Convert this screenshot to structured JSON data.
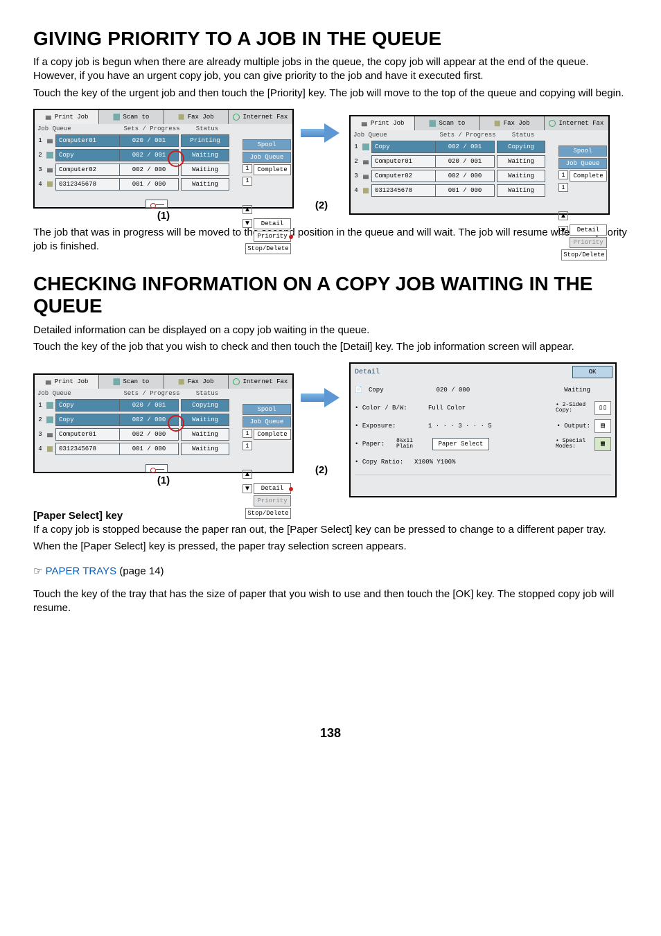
{
  "heading1": "GIVING PRIORITY TO A JOB IN THE QUEUE",
  "para1a": "If a copy job is begun when there are already multiple jobs in the queue, the copy job will appear at the end of the queue. However, if you have an urgent copy job, you can give priority to the job and have it executed first.",
  "para1b": "Touch the key of the urgent job and then touch the [Priority] key. The job will move to the top of the queue and copying will begin.",
  "tabs": [
    "Print Job",
    "Scan to",
    "Fax Job",
    "Internet Fax"
  ],
  "cols": {
    "c1": "Job Queue",
    "c2": "Sets / Progress",
    "c3": "Status"
  },
  "fig1_left": {
    "rows": [
      {
        "icon": "print",
        "name": "Computer01",
        "prog": "020 / 001",
        "status": "Printing",
        "shade": true
      },
      {
        "icon": "copy",
        "name": "Copy",
        "prog": "002 / 001",
        "status": "Waiting",
        "shade": true
      },
      {
        "icon": "print",
        "name": "Computer02",
        "prog": "002 / 000",
        "status": "Waiting",
        "shade": false
      },
      {
        "icon": "fax",
        "name": "0312345678",
        "prog": "001 / 000",
        "status": "Waiting",
        "shade": false
      }
    ],
    "side": {
      "spool": "Spool",
      "jobq": "Job Queue",
      "complete": "Complete",
      "detail": "Detail",
      "priority": "Priority",
      "stop": "Stop/Delete",
      "n1": "1",
      "n2": "1"
    }
  },
  "fig1_right": {
    "rows": [
      {
        "icon": "copy",
        "name": "Copy",
        "prog": "002 / 001",
        "status": "Copying",
        "shade": true
      },
      {
        "icon": "print",
        "name": "Computer01",
        "prog": "020 / 001",
        "status": "Waiting",
        "shade": false
      },
      {
        "icon": "print",
        "name": "Computer02",
        "prog": "002 / 000",
        "status": "Waiting",
        "shade": false
      },
      {
        "icon": "fax",
        "name": "0312345678",
        "prog": "001 / 000",
        "status": "Waiting",
        "shade": false
      }
    ],
    "side": {
      "spool": "Spool",
      "jobq": "Job Queue",
      "complete": "Complete",
      "detail": "Detail",
      "priority": "Priority",
      "stop": "Stop/Delete",
      "n1": "1",
      "n2": "1"
    }
  },
  "cap1": "(1)",
  "cap2": "(2)",
  "para1c": "The job that was in progress will be moved to the second position in the queue and will wait. The job will resume when the priority job is finished.",
  "heading2": "CHECKING INFORMATION ON A COPY JOB WAITING IN THE QUEUE",
  "para2a": "Detailed information can be displayed on a copy job waiting in the queue.",
  "para2b": "Touch the key of the job that you wish to check and then touch the [Detail] key. The job information screen will appear.",
  "fig2_left": {
    "rows": [
      {
        "icon": "copy",
        "name": "Copy",
        "prog": "020 / 001",
        "status": "Copying",
        "shade": true
      },
      {
        "icon": "copy",
        "name": "Copy",
        "prog": "002 / 000",
        "status": "Waiting",
        "shade": true
      },
      {
        "icon": "print",
        "name": "Computer01",
        "prog": "002 / 000",
        "status": "Waiting",
        "shade": false
      },
      {
        "icon": "fax",
        "name": "0312345678",
        "prog": "001 / 000",
        "status": "Waiting",
        "shade": false
      }
    ],
    "side": {
      "spool": "Spool",
      "jobq": "Job Queue",
      "complete": "Complete",
      "detail": "Detail",
      "priority": "Priority",
      "stop": "Stop/Delete",
      "n1": "1",
      "n2": "1"
    }
  },
  "detail": {
    "title": "Detail",
    "ok": "OK",
    "jobname": "Copy",
    "progress": "020 / 000",
    "status": "Waiting",
    "color_l": "Color / B/W:",
    "color_v": "Full Color",
    "twos_l": "2-Sided Copy:",
    "exp_l": "Exposure:",
    "exp_v": "1 · · · 3 · · · 5",
    "out_l": "Output:",
    "paper_l": "Paper:",
    "paper_v": "8½x11 Plain",
    "paper_btn": "Paper Select",
    "sm_l": "Special Modes:",
    "ratio_l": "Copy Ratio:",
    "ratio_v": "X100% Y100%"
  },
  "sub": "[Paper Select] key",
  "para3a": "If a copy job is stopped because the paper ran out, the [Paper Select] key can be pressed to change to a different paper tray.",
  "para3b": "When the [Paper Select] key is pressed, the paper tray selection screen appears.",
  "ref_icon": "☞",
  "ref_link": "PAPER TRAYS",
  "ref_tail": " (page 14)",
  "para3c": "Touch the key of the tray that has the size of paper that you wish to use and then touch the [OK] key. The stopped copy job will resume.",
  "pagenum": "138"
}
